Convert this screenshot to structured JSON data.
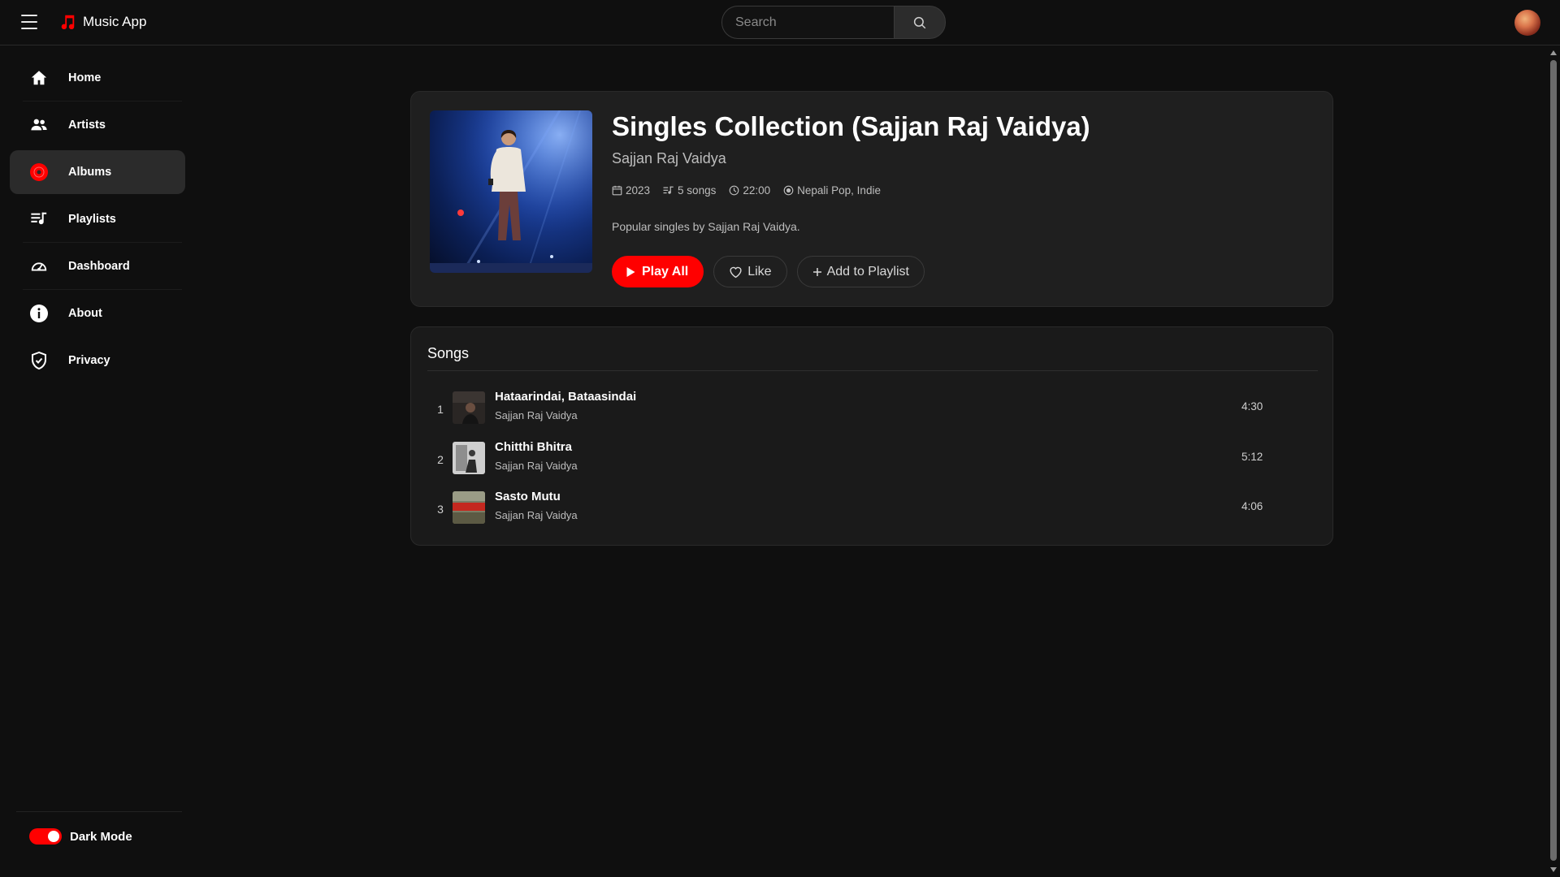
{
  "app": {
    "title": "Music App",
    "accent": "#ff0000",
    "background": "#0f0f0f"
  },
  "search": {
    "placeholder": "Search",
    "value": ""
  },
  "sidebar": {
    "items": [
      {
        "label": "Home",
        "icon": "home-icon",
        "active": false
      },
      {
        "label": "Artists",
        "icon": "users-icon",
        "active": false
      },
      {
        "label": "Albums",
        "icon": "disc-icon",
        "active": true
      },
      {
        "label": "Playlists",
        "icon": "playlist-icon",
        "active": false
      },
      {
        "label": "Dashboard",
        "icon": "gauge-icon",
        "active": false
      },
      {
        "label": "About",
        "icon": "info-icon",
        "active": false
      },
      {
        "label": "Privacy",
        "icon": "shield-icon",
        "active": false
      }
    ],
    "dark_mode_label": "Dark Mode",
    "dark_mode_on": true
  },
  "album": {
    "title": "Singles Collection (Sajjan Raj Vaidya)",
    "artist": "Sajjan Raj Vaidya",
    "year": "2023",
    "songs_count": "5 songs",
    "duration": "22:00",
    "genres": "Nepali Pop, Indie",
    "description": "Popular singles by Sajjan Raj Vaidya.",
    "play_label": "Play All",
    "like_label": "Like",
    "add_label": "Add to Playlist"
  },
  "songs": {
    "heading": "Songs",
    "rows": [
      {
        "num": "1",
        "title": "Hataarindai, Bataasindai",
        "artist": "Sajjan Raj Vaidya",
        "duration": "4:30"
      },
      {
        "num": "2",
        "title": "Chitthi Bhitra",
        "artist": "Sajjan Raj Vaidya",
        "duration": "5:12"
      },
      {
        "num": "3",
        "title": "Sasto Mutu",
        "artist": "Sajjan Raj Vaidya",
        "duration": "4:06"
      }
    ]
  }
}
